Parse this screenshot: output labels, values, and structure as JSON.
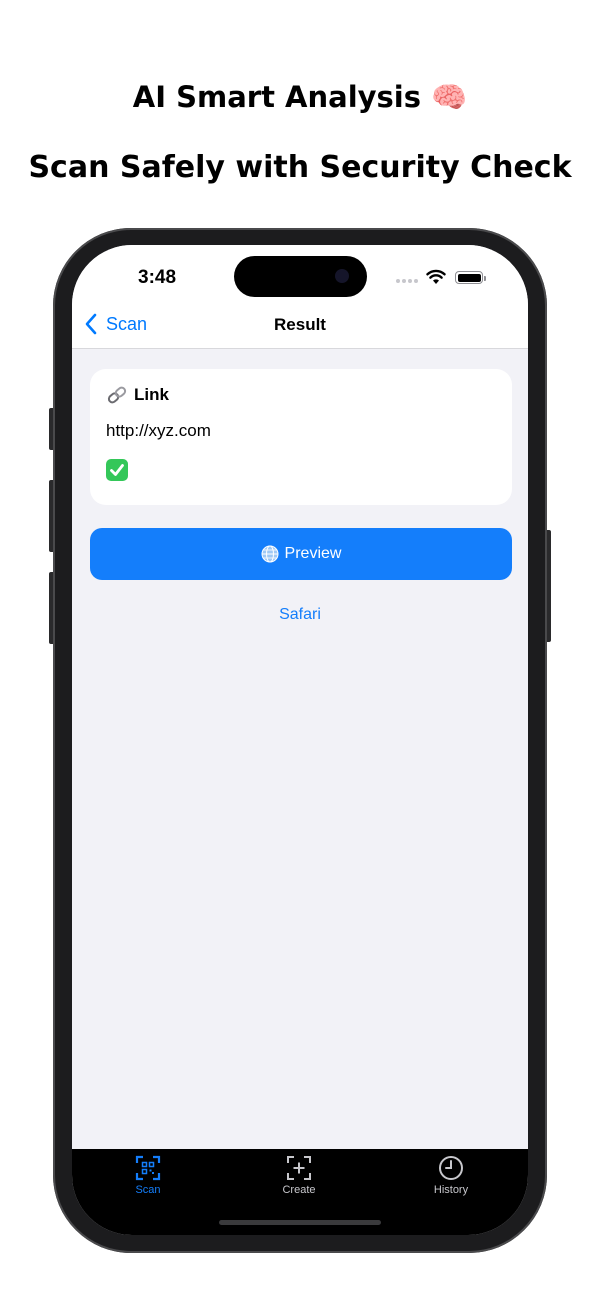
{
  "headline": {
    "line1": "AI Smart Analysis 🧠",
    "line2": "Scan Safely with Security Check"
  },
  "status_bar": {
    "time": "3:48"
  },
  "nav": {
    "back_label": "Scan",
    "title": "Result"
  },
  "result_card": {
    "label": "Link",
    "url": "http://xyz.com"
  },
  "actions": {
    "preview_label": "Preview",
    "safari_label": "Safari"
  },
  "tabbar": {
    "items": [
      {
        "label": "Scan"
      },
      {
        "label": "Create"
      },
      {
        "label": "History"
      }
    ],
    "active_color": "#147efb"
  },
  "colors": {
    "accent": "#147efb",
    "screen_background": "#f2f2f7",
    "success": "#34c759"
  }
}
